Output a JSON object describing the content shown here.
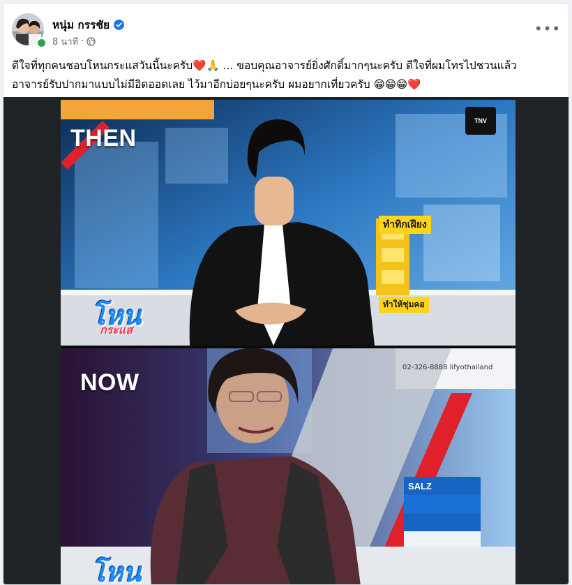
{
  "post": {
    "author": "หนุ่ม กรรชัย",
    "time": "8 นาที",
    "separator": "·",
    "more": "•••",
    "caption_line1": "ดีใจที่ทุกคนชอบโหนกระแสวันนี้นะครับ❤️🙏 ... ขอบคุณอาจารย์ยิ่งศักดิ์มากๆนะครับ ดีใจที่ผมโทรไปชวนแล้ว",
    "caption_line2": "อาจารย์รับปากมาแบบไม่มีอิดออดเลย ไว้มาอีกบ่อยๆนะครับ ผมอยากเที่ยวครับ 😁😁😁❤️"
  },
  "media": {
    "top": {
      "label": "THEN",
      "show_logo": "โหน",
      "show_logo_sub": "กระแส",
      "sign_text": "ทำทิกเฝียง",
      "sign_text2": "ทำให้ชุ่มคอ"
    },
    "bottom": {
      "label": "NOW",
      "show_logo": "โหน",
      "contact": "02-326-8888   lifyothailand",
      "product": "SALZ"
    }
  },
  "colors": {
    "verified": "#1877f2",
    "online": "#31a24c",
    "studio_blue": "#1e5fa8",
    "accent_red": "#e0202a"
  }
}
